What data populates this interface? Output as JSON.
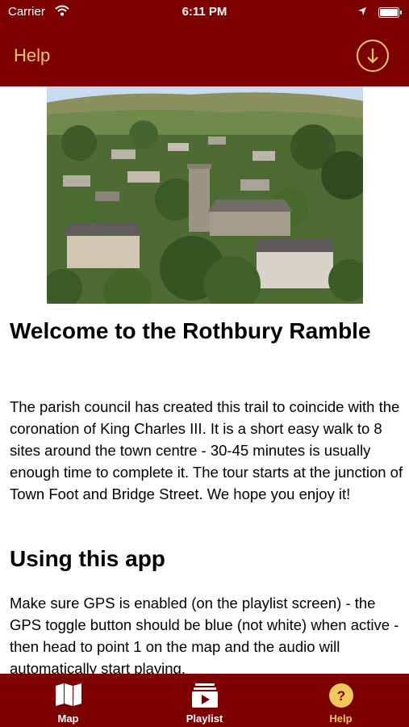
{
  "status_bar": {
    "carrier": "Carrier",
    "time": "6:11 PM"
  },
  "nav": {
    "title": "Help",
    "download_icon": "download-circle-icon"
  },
  "content": {
    "hero_image_alt": "Rothbury village",
    "heading_1": "Welcome to the Rothbury Ramble",
    "paragraph_1": "The parish council has created this trail to coincide with the coronation of King Charles III. It is a short easy walk to 8 sites around the town centre - 30-45 minutes is usually enough time to complete it. The tour starts at the junction of Town Foot and Bridge Street. We hope you enjoy it!",
    "heading_2": "Using this app",
    "paragraph_2": "Make sure GPS is enabled (on the playlist screen) - the GPS toggle button should be blue (not white) when active - then head to point 1 on the map and the audio will automatically start playing."
  },
  "tab_bar": {
    "tabs": [
      {
        "label": "Map",
        "icon": "map-icon",
        "active": false
      },
      {
        "label": "Playlist",
        "icon": "playlist-icon",
        "active": false
      },
      {
        "label": "Help",
        "icon": "help-icon",
        "active": true
      }
    ]
  },
  "colors": {
    "brand": "#7d0000",
    "accent": "#f0c75a"
  }
}
